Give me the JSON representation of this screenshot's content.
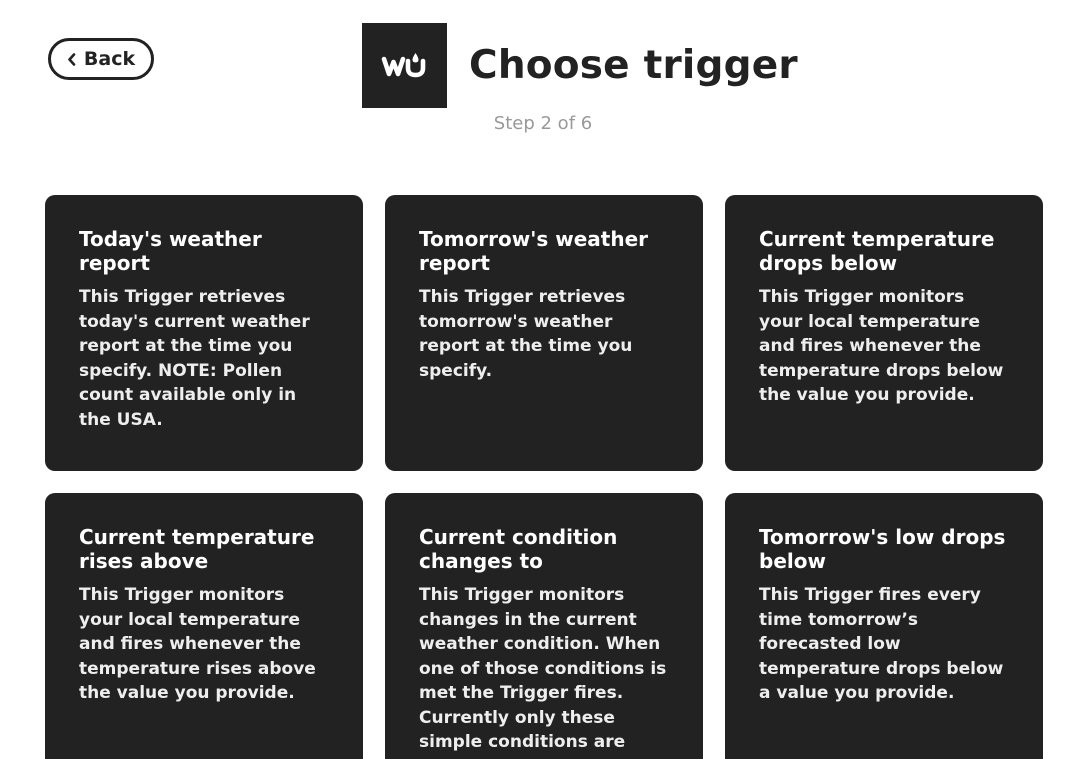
{
  "nav": {
    "back_label": "Back",
    "back_icon": "chevron-left-icon"
  },
  "header": {
    "logo_icon": "weather-underground-logo",
    "logo_text": "wu",
    "title": "Choose trigger",
    "step": "Step 2 of 6"
  },
  "colors": {
    "card_background": "#222222",
    "page_background": "#ffffff",
    "step_text": "#999999"
  },
  "triggers": [
    {
      "title": "Today's weather report",
      "description": "This Trigger retrieves today's current weather report at the time you specify. NOTE: Pollen count available only in the USA."
    },
    {
      "title": "Tomorrow's weather report",
      "description": "This Trigger retrieves tomorrow's weather report at the time you specify."
    },
    {
      "title": "Current temperature drops below",
      "description": "This Trigger monitors your local temperature and fires whenever the temperature drops below the value you provide."
    },
    {
      "title": "Current temperature rises above",
      "description": "This Trigger monitors your local temperature and fires whenever the temperature rises above the value you provide."
    },
    {
      "title": "Current condition changes to",
      "description": "This Trigger monitors changes in the current weather condition. When one of those conditions is met the Trigger fires. Currently only these simple conditions are supported:"
    },
    {
      "title": "Tomorrow's low drops below",
      "description": "This Trigger fires every time tomorrow’s forecasted low temperature drops below a value you provide."
    }
  ]
}
